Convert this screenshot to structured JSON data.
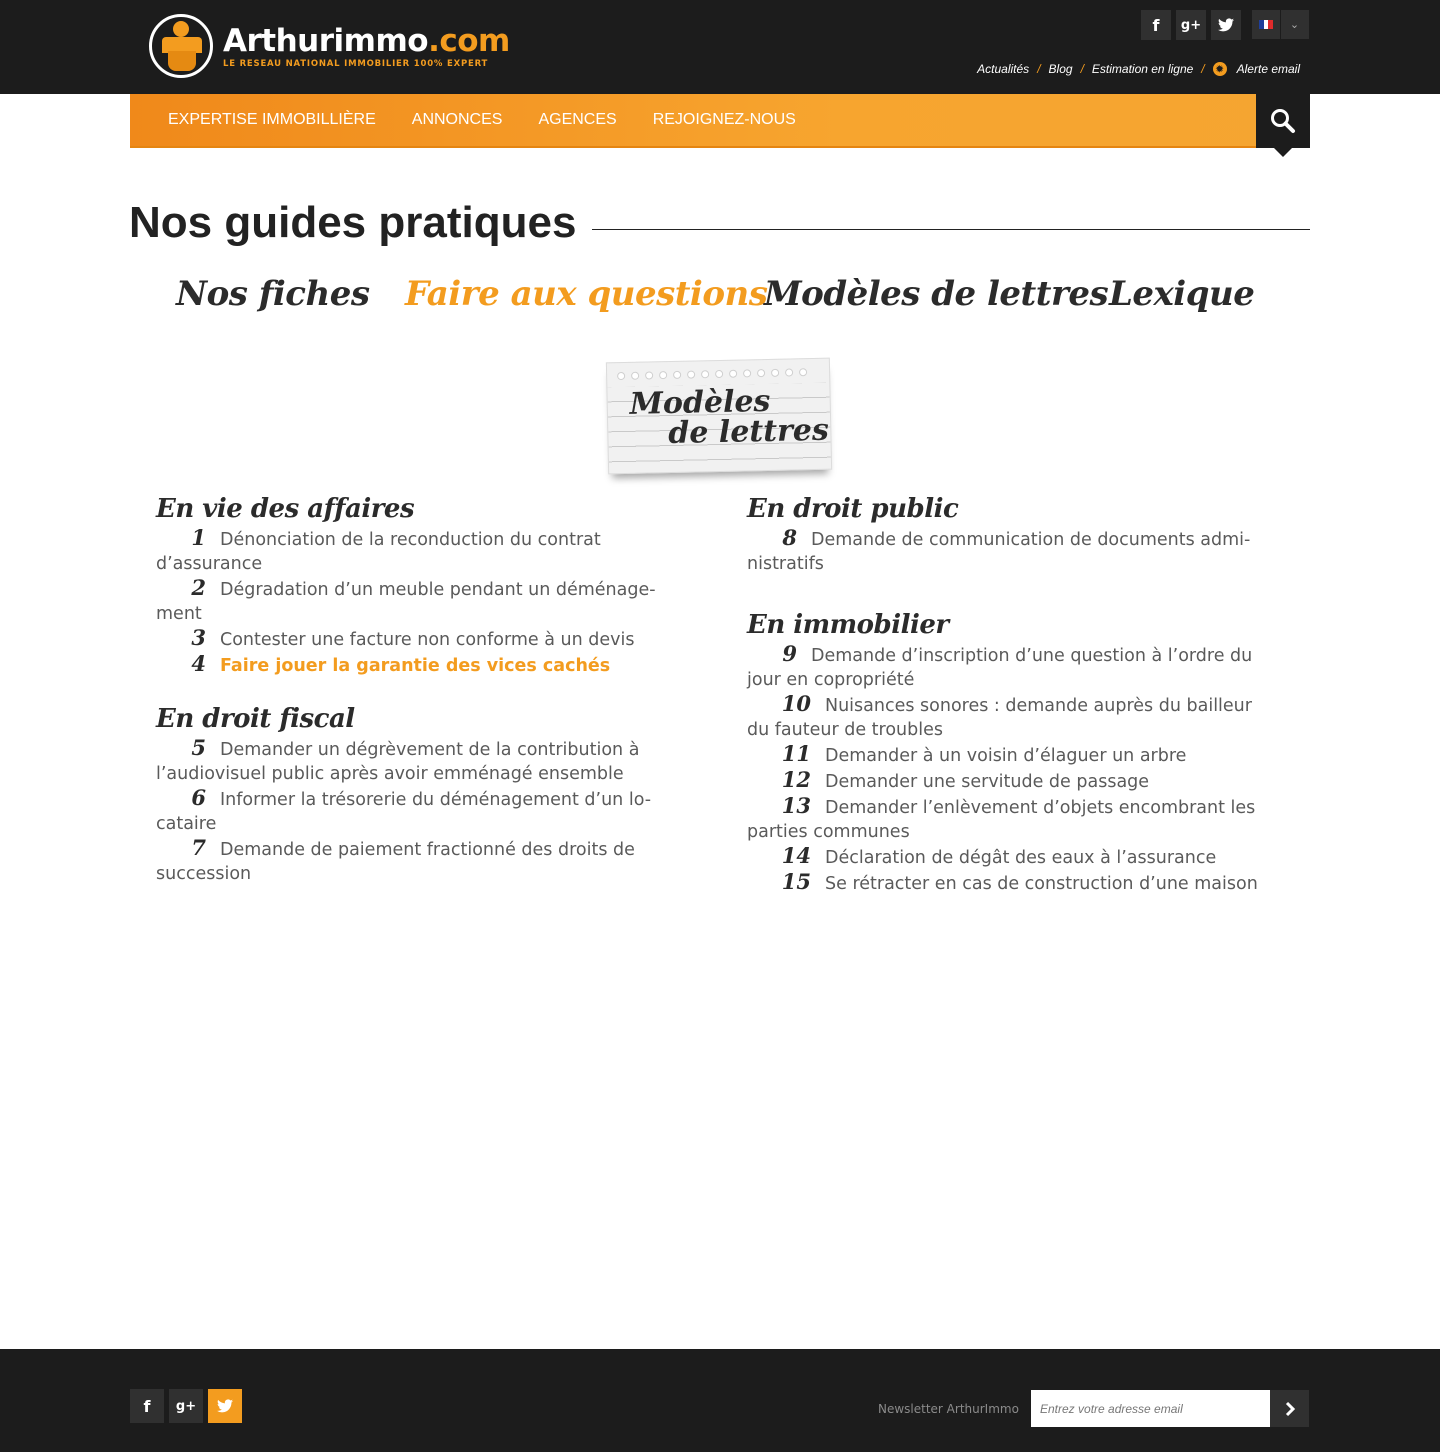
{
  "header": {
    "logo": {
      "name_main": "Arthurimmo",
      "name_dot": ".com",
      "tagline": "LE RESEAU NATIONAL IMMOBILIER 100% EXPERT"
    },
    "social": [
      {
        "label": "f",
        "icon": "facebook-icon"
      },
      {
        "label": "g+",
        "icon": "google-plus-icon"
      },
      {
        "label": "t",
        "icon": "twitter-icon"
      }
    ],
    "language": {
      "flag_colors": [
        "#1f3f9a",
        "#ffffff",
        "#e02b2b"
      ],
      "dropdown": "chevron-down-icon"
    },
    "links": [
      "Actualités",
      "Blog",
      "Estimation en ligne",
      "Alerte email"
    ],
    "link_separator": "/"
  },
  "nav": {
    "items": [
      "EXPERTISE IMMOBILLIÈRE",
      "ANNONCES",
      "AGENCES",
      "REJOIGNEZ-NOUS"
    ],
    "search_icon": "search-icon"
  },
  "page": {
    "title": "Nos guides pratiques",
    "tabs": [
      "Nos fiches",
      "Faire aux questions",
      "Modèles de lettres",
      "Lexique"
    ],
    "active_tab": 1,
    "note": {
      "line1": "Modèles",
      "line2": "de lettres"
    }
  },
  "left_column": [
    {
      "title": "En vie des affaires",
      "items": [
        {
          "num": "1",
          "text": "Dénonciation de la reconduction du contrat d’assurance"
        },
        {
          "num": "2",
          "text": "Dégradation d’un meuble pendant un déménage-ment"
        },
        {
          "num": "3",
          "text": "Contester une facture non conforme à un devis"
        },
        {
          "num": "4",
          "text": "Faire jouer la garantie des vices cachés",
          "highlight": true
        }
      ]
    },
    {
      "title": "En droit fiscal",
      "items": [
        {
          "num": "5",
          "text": "Demander un dégrèvement de la contribution à l’audiovisuel public après avoir emménagé ensemble"
        },
        {
          "num": "6",
          "text": "Informer la trésorerie du déménagement d’un lo-cataire"
        },
        {
          "num": "7",
          "text": "Demande de paiement fractionné des droits de succession"
        }
      ]
    }
  ],
  "right_column": [
    {
      "title": "En droit public",
      "items": [
        {
          "num": "8",
          "text": "Demande de communication de documents admi-nistratifs"
        }
      ]
    },
    {
      "title": "En immobilier",
      "items": [
        {
          "num": "9",
          "text": "Demande d’inscription d’une question à l’ordre du jour en copropriété"
        },
        {
          "num": "10",
          "text": "Nuisances sonores : demande auprès du bailleur du fauteur de troubles"
        },
        {
          "num": "11",
          "text": "Demander à un voisin d’élaguer un arbre"
        },
        {
          "num": "12",
          "text": "Demander une servitude de passage"
        },
        {
          "num": "13",
          "text": "Demander l’enlèvement d’objets encombrant les parties communes"
        },
        {
          "num": "14",
          "text": "Déclaration de dégât des eaux à l’assurance"
        },
        {
          "num": "15",
          "text": "Se rétracter en cas de construction d’une maison"
        }
      ]
    }
  ],
  "footer": {
    "social": [
      {
        "label": "f",
        "icon": "facebook-icon"
      },
      {
        "label": "g+",
        "icon": "google-plus-icon"
      },
      {
        "label": "t",
        "icon": "twitter-icon"
      }
    ],
    "newsletter_label": "Newsletter ArthurImmo",
    "newsletter_placeholder": "Entrez votre adresse email",
    "submit_icon": "chevron-right-icon"
  },
  "colors": {
    "accent": "#f39c1f",
    "dark": "#1c1c1c",
    "text": "#5a5a5a"
  }
}
